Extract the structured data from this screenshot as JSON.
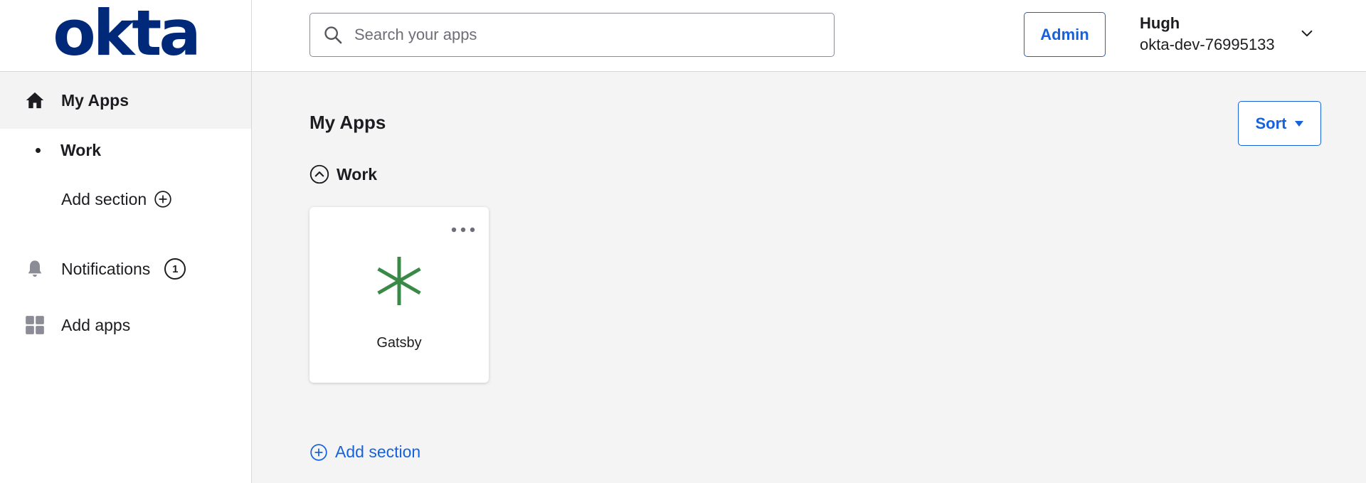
{
  "logo": {
    "text": "okta"
  },
  "colors": {
    "brand": "#00297a",
    "accent": "#1662dd",
    "app_icon": "#3a8a47"
  },
  "header": {
    "search": {
      "placeholder": "Search your apps",
      "value": ""
    },
    "admin_label": "Admin",
    "user": {
      "name": "Hugh",
      "org": "okta-dev-76995133"
    }
  },
  "sidebar": {
    "my_apps": {
      "label": "My Apps",
      "icon": "home-icon"
    },
    "work": {
      "label": "Work"
    },
    "add_section": {
      "label": "Add section",
      "icon": "plus-circle-icon"
    },
    "notifications": {
      "label": "Notifications",
      "icon": "bell-icon",
      "count": "1"
    },
    "add_apps": {
      "label": "Add apps",
      "icon": "grid-icon"
    }
  },
  "main": {
    "title": "My Apps",
    "sort_label": "Sort",
    "section": {
      "title": "Work",
      "icon": "chevron-up-circle-icon"
    },
    "apps": [
      {
        "name": "Gatsby",
        "icon": "asterisk-icon"
      }
    ],
    "add_section_label": "Add section"
  }
}
